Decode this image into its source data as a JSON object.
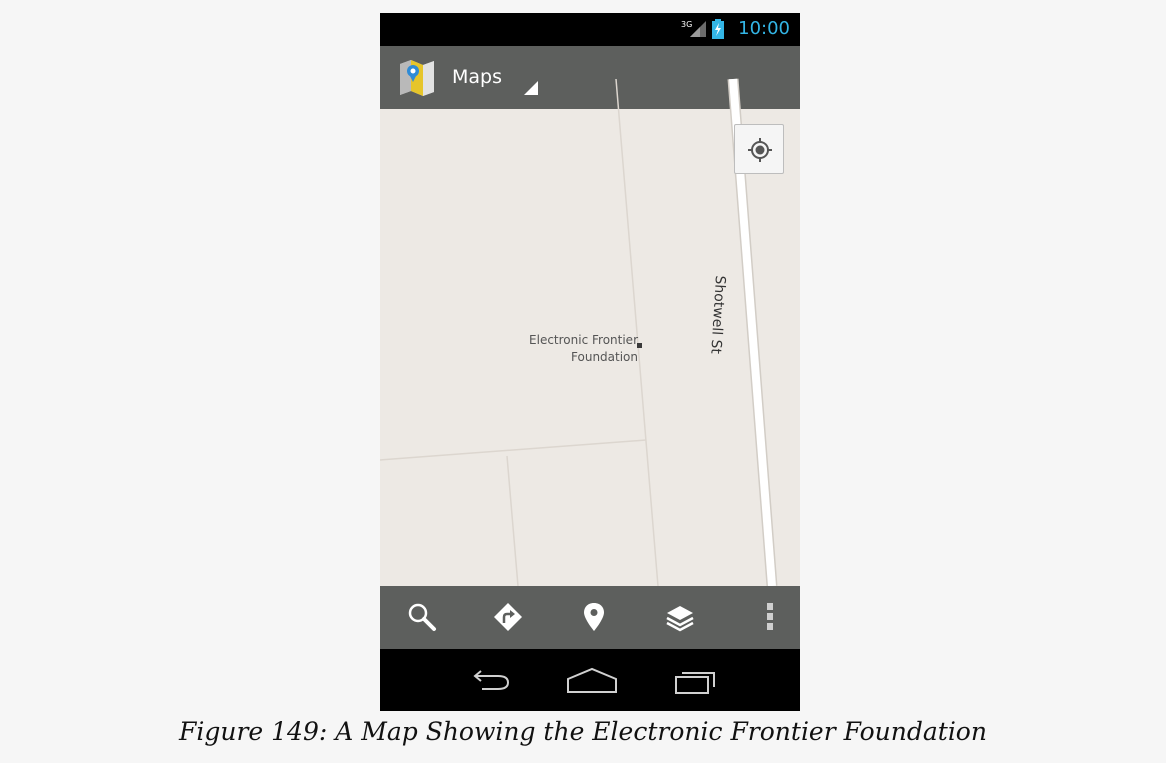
{
  "status_bar": {
    "network_type": "3G",
    "clock": "10:00",
    "accent_color": "#33b5e5"
  },
  "action_bar": {
    "app_icon": "maps-app-icon",
    "title": "Maps",
    "spinner_icon": "spinner-triangle-icon"
  },
  "map": {
    "locate_icon": "my-location-icon",
    "street_label": "Shotwell St",
    "poi": {
      "label_line1": "Electronic Frontier",
      "label_line2": "Foundation"
    }
  },
  "toolbar": {
    "buttons": [
      {
        "icon": "search-icon"
      },
      {
        "icon": "directions-icon"
      },
      {
        "icon": "places-pin-icon"
      },
      {
        "icon": "layers-icon"
      },
      {
        "icon": "overflow-menu-icon"
      }
    ]
  },
  "nav_bar": {
    "buttons": [
      {
        "icon": "back-icon"
      },
      {
        "icon": "home-icon"
      },
      {
        "icon": "recents-icon"
      }
    ]
  },
  "caption": "Figure 149: A Map Showing the Electronic Frontier Foundation"
}
